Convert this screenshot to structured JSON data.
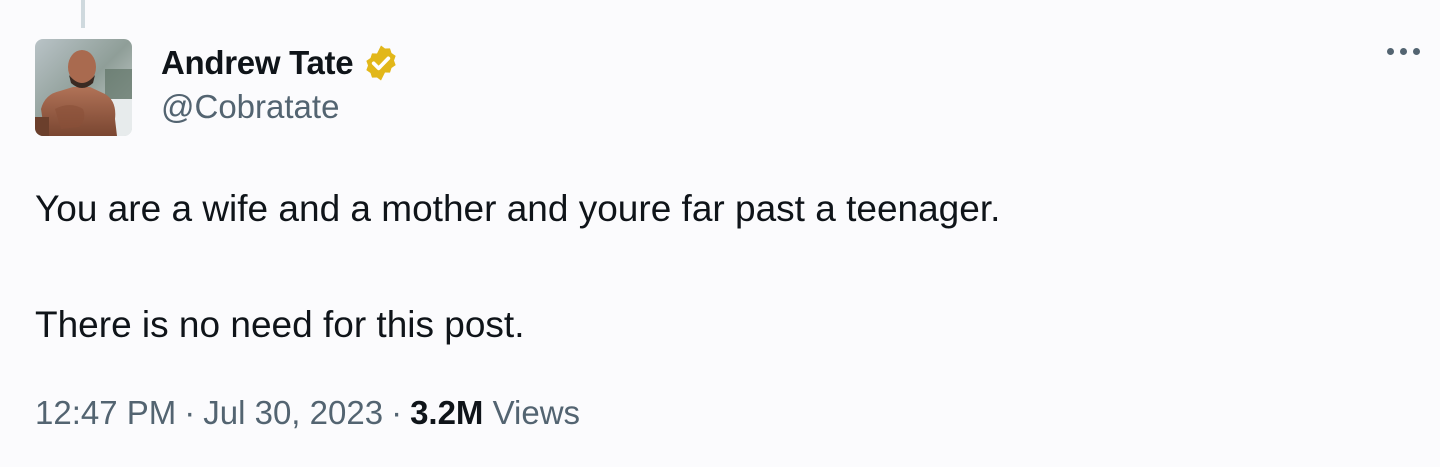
{
  "author": {
    "display_name": "Andrew Tate",
    "handle": "@Cobratate",
    "verified_badge_color": "#e2b719",
    "avatar_icon": "profile-photo"
  },
  "tweet": {
    "paragraphs": [
      "You are a wife and a mother and youre far past a teenager.",
      "There is no need for this post."
    ]
  },
  "meta": {
    "time": "12:47 PM",
    "separator": "·",
    "date": "Jul 30, 2023",
    "views_count": "3.2M",
    "views_label": "Views"
  },
  "actions": {
    "more_icon": "more-horizontal-icon"
  }
}
